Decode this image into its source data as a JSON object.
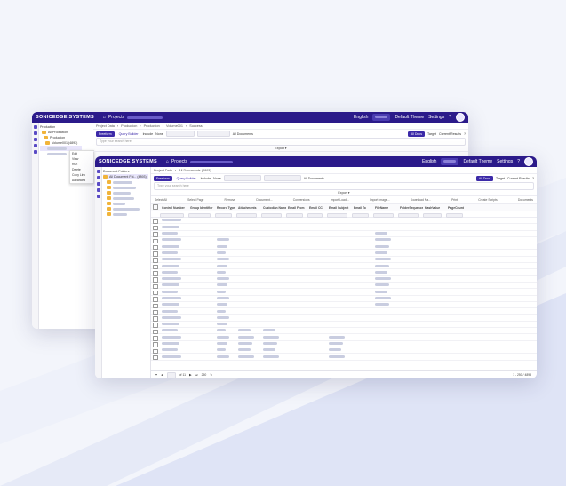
{
  "app": {
    "brand": "SONICEDGE SYSTEMS",
    "projects_label": "Projects"
  },
  "header": {
    "language": "English",
    "theme": "Default Theme",
    "settings": "Settings"
  },
  "back": {
    "side_title": "Production",
    "tree": [
      "All Production",
      "Production",
      "Volume001 (4893)"
    ],
    "tabs": [
      "Project Data",
      "Production",
      "Production",
      "Volume001",
      "Success"
    ],
    "context_menu": [
      "Edit",
      "View",
      "Run",
      "Delete",
      "Copy Link",
      "Advanced"
    ],
    "toolbar": {
      "freeform": "Freeform",
      "query_builder": "Query Builder",
      "include": "Include",
      "none": "None",
      "all_documents": "All Documents",
      "all_docs_btn": "All Docs",
      "target": "Target",
      "current_results": "Current Results"
    },
    "search_placeholder": "Type your search here",
    "export": "Export"
  },
  "front": {
    "side_title": "Document Folders",
    "tree_root": "All Document Fol... (4893)",
    "tabs": [
      "Project Data",
      "All Documents (4893)"
    ],
    "toolbar": {
      "freeform": "Freeform",
      "query_builder": "Query Builder",
      "include": "Include",
      "none": "None",
      "all_documents": "All Documents",
      "all_docs_btn": "All Docs",
      "target": "Target",
      "current_results": "Current Results"
    },
    "search_placeholder": "Type your search here",
    "export": "Export",
    "actions": [
      "Select All",
      "Select Page",
      "Remove",
      "Document...",
      "Conversions",
      "Import Load...",
      "Import Image...",
      "Download Na...",
      "Print",
      "Create Scripts",
      "Documents"
    ],
    "columns": [
      "Control Number",
      "Group Identifier",
      "Record Type",
      "Attachments",
      "Custodian Name",
      "Email From",
      "Email CC",
      "Email Subject",
      "Email To",
      "FileName",
      "FolderSequence",
      "HashValue",
      "PageCount"
    ],
    "footer": {
      "page_label": "of 11",
      "page_size": "250",
      "count": "1 - 250 / 4893"
    }
  },
  "colors": {
    "brand": "#2b1a8a",
    "accent": "#3c2aa8"
  }
}
